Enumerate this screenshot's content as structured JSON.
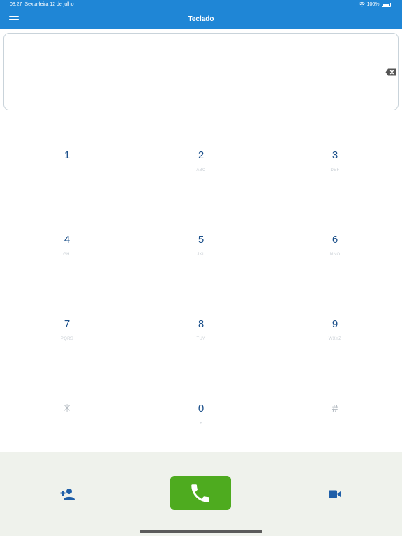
{
  "status": {
    "time": "08:27",
    "date": "Sexta-feira 12 de julho",
    "battery": "100%"
  },
  "header": {
    "title": "Teclado"
  },
  "display": {
    "value": ""
  },
  "keypad": [
    {
      "digit": "1",
      "letters": ""
    },
    {
      "digit": "2",
      "letters": "ABC"
    },
    {
      "digit": "3",
      "letters": "DEF"
    },
    {
      "digit": "4",
      "letters": "GHI"
    },
    {
      "digit": "5",
      "letters": "JKL"
    },
    {
      "digit": "6",
      "letters": "MNO"
    },
    {
      "digit": "7",
      "letters": "PQRS"
    },
    {
      "digit": "8",
      "letters": "TUV"
    },
    {
      "digit": "9",
      "letters": "WXYZ"
    },
    {
      "digit": "✳",
      "letters": ""
    },
    {
      "digit": "0",
      "letters": "+"
    },
    {
      "digit": "#",
      "letters": ""
    }
  ],
  "icons": {
    "menu": "hamburger-icon",
    "backspace": "backspace-icon",
    "call": "phone-icon",
    "add_contact": "person-add-icon",
    "video": "video-camera-icon"
  },
  "colors": {
    "brand": "#1f86d6",
    "call": "#4eab1f",
    "digit": "#1a4f8a"
  }
}
